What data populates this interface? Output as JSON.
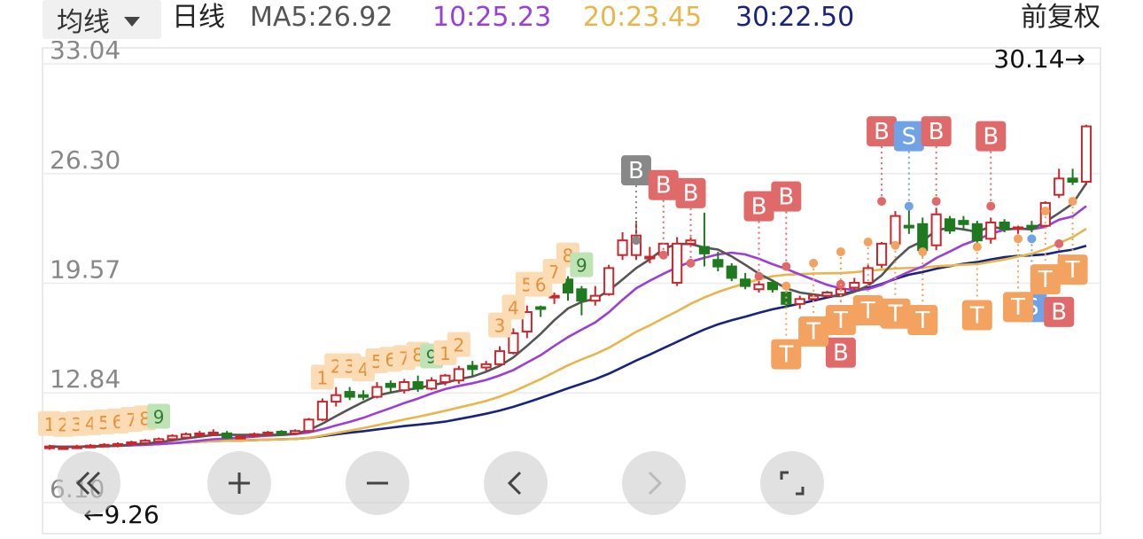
{
  "header": {
    "ma_selector": "均线",
    "period": "日线",
    "ma5": "MA5:26.92",
    "ma10": "10:25.23",
    "ma20": "20:23.45",
    "ma30": "30:22.50",
    "adjust": "前复权"
  },
  "colors": {
    "up": "#c8282d",
    "down": "#1f7a1f",
    "ma5": "#555555",
    "ma10": "#9b3fd6",
    "ma20": "#e8b64a",
    "ma30": "#1a237e",
    "buy": "#e06a6a",
    "sell": "#6fa3e6",
    "buy_gray": "#888888",
    "t_box": "#f3a35f"
  },
  "controls": [
    {
      "name": "double-left-icon"
    },
    {
      "name": "plus-icon"
    },
    {
      "name": "minus-icon"
    },
    {
      "name": "left-icon"
    },
    {
      "name": "right-icon"
    },
    {
      "name": "fullscreen-icon"
    }
  ],
  "chart_data": {
    "type": "candlestick",
    "y_axis_labels": [
      "33.04",
      "26.30",
      "19.57",
      "12.84",
      "6.10"
    ],
    "ylim": [
      6.1,
      33.04
    ],
    "max_label": "30.14→",
    "min_label": "←9.26",
    "candles": [
      [
        9.5,
        9.55,
        9.35,
        9.65
      ],
      [
        9.45,
        9.5,
        9.35,
        9.6
      ],
      [
        9.5,
        9.55,
        9.4,
        9.65
      ],
      [
        9.55,
        9.6,
        9.45,
        9.7
      ],
      [
        9.6,
        9.65,
        9.5,
        9.75
      ],
      [
        9.62,
        9.7,
        9.5,
        9.8
      ],
      [
        9.7,
        9.8,
        9.6,
        9.9
      ],
      [
        9.75,
        9.9,
        9.65,
        10.0
      ],
      [
        9.85,
        10.0,
        9.75,
        10.1
      ],
      [
        10.0,
        10.2,
        9.9,
        10.3
      ],
      [
        10.1,
        10.3,
        10.0,
        10.4
      ],
      [
        10.25,
        10.35,
        10.1,
        10.5
      ],
      [
        10.35,
        10.4,
        10.2,
        10.6
      ],
      [
        10.35,
        10.1,
        10.0,
        10.5
      ],
      [
        10.1,
        10.15,
        10.0,
        10.25
      ],
      [
        10.2,
        10.3,
        10.1,
        10.4
      ],
      [
        10.3,
        10.4,
        10.2,
        10.5
      ],
      [
        10.45,
        10.35,
        10.25,
        10.55
      ],
      [
        10.35,
        10.5,
        10.3,
        10.6
      ],
      [
        10.5,
        11.2,
        10.4,
        11.3
      ],
      [
        11.2,
        12.3,
        11.1,
        12.5
      ],
      [
        12.3,
        12.7,
        12.0,
        13.2
      ],
      [
        12.9,
        12.6,
        12.4,
        13.2
      ],
      [
        12.7,
        12.6,
        12.4,
        13.0
      ],
      [
        12.6,
        13.2,
        12.5,
        13.5
      ],
      [
        13.4,
        13.2,
        12.8,
        13.6
      ],
      [
        13.0,
        13.5,
        12.8,
        13.7
      ],
      [
        13.5,
        13.1,
        12.9,
        13.9
      ],
      [
        13.1,
        13.6,
        13.0,
        13.8
      ],
      [
        13.5,
        13.9,
        13.3,
        14.0
      ],
      [
        13.6,
        14.3,
        13.4,
        14.5
      ],
      [
        14.5,
        14.3,
        13.9,
        14.8
      ],
      [
        14.4,
        14.6,
        14.2,
        14.8
      ],
      [
        14.6,
        15.4,
        14.5,
        15.7
      ],
      [
        15.3,
        16.5,
        15.2,
        16.8
      ],
      [
        16.6,
        17.8,
        16.2,
        18.2
      ],
      [
        18.1,
        18.0,
        17.5,
        18.2
      ],
      [
        18.8,
        18.8,
        18.3,
        19.0
      ],
      [
        19.8,
        19.0,
        18.5,
        20.0
      ],
      [
        19.2,
        18.5,
        17.6,
        19.4
      ],
      [
        18.5,
        18.8,
        18.2,
        19.4
      ],
      [
        18.9,
        20.5,
        18.8,
        20.7
      ],
      [
        21.3,
        22.2,
        21.0,
        22.7
      ],
      [
        21.3,
        22.5,
        21.0,
        23.4
      ],
      [
        21.2,
        21.2,
        20.8,
        21.8
      ],
      [
        21.3,
        22.0,
        21.2,
        22.0
      ],
      [
        19.6,
        22.0,
        19.4,
        22.4
      ],
      [
        22.0,
        22.2,
        21.8,
        22.4
      ],
      [
        21.8,
        21.4,
        20.6,
        23.9
      ],
      [
        21.0,
        20.6,
        20.3,
        21.5
      ],
      [
        20.6,
        19.9,
        19.7,
        20.8
      ],
      [
        19.8,
        19.4,
        19.2,
        20.2
      ],
      [
        19.2,
        19.5,
        19.0,
        19.7
      ],
      [
        19.6,
        19.2,
        19.0,
        19.8
      ],
      [
        19.0,
        18.3,
        18.1,
        19.1
      ],
      [
        18.3,
        18.6,
        18.0,
        18.8
      ],
      [
        18.6,
        18.8,
        18.6,
        18.9
      ],
      [
        18.8,
        19.0,
        18.7,
        19.1
      ],
      [
        18.9,
        19.2,
        18.8,
        19.3
      ],
      [
        19.3,
        19.6,
        19.1,
        19.9
      ],
      [
        19.6,
        20.5,
        19.5,
        20.7
      ],
      [
        20.7,
        22.0,
        20.5,
        22.1
      ],
      [
        22.0,
        23.7,
        21.8,
        24.0
      ],
      [
        23.1,
        23.0,
        22.6,
        24.1
      ],
      [
        23.2,
        21.6,
        21.2,
        23.6
      ],
      [
        21.9,
        23.8,
        21.6,
        24.2
      ],
      [
        23.5,
        22.8,
        22.6,
        23.7
      ],
      [
        23.4,
        23.2,
        22.8,
        23.7
      ],
      [
        23.2,
        22.2,
        22.0,
        23.4
      ],
      [
        22.3,
        23.3,
        22.0,
        23.6
      ],
      [
        23.3,
        22.9,
        22.7,
        23.5
      ],
      [
        22.9,
        23.0,
        22.6,
        23.1
      ],
      [
        23.1,
        23.0,
        22.7,
        23.4
      ],
      [
        23.1,
        24.5,
        23.0,
        24.6
      ],
      [
        25.0,
        26.0,
        24.8,
        26.6
      ],
      [
        26.0,
        25.8,
        25.6,
        26.6
      ],
      [
        25.8,
        29.2,
        25.6,
        29.3
      ]
    ],
    "tags": [
      {
        "i": 0,
        "n": "1"
      },
      {
        "i": 1,
        "n": "2"
      },
      {
        "i": 2,
        "n": "3"
      },
      {
        "i": 3,
        "n": "4"
      },
      {
        "i": 4,
        "n": "5"
      },
      {
        "i": 5,
        "n": "6"
      },
      {
        "i": 6,
        "n": "7"
      },
      {
        "i": 7,
        "n": "8"
      },
      {
        "i": 8,
        "n": "9"
      },
      {
        "i": 20,
        "n": "1"
      },
      {
        "i": 21,
        "n": "2"
      },
      {
        "i": 22,
        "n": "3"
      },
      {
        "i": 23,
        "n": "4"
      },
      {
        "i": 24,
        "n": "5"
      },
      {
        "i": 25,
        "n": "6"
      },
      {
        "i": 26,
        "n": "7"
      },
      {
        "i": 27,
        "n": "8"
      },
      {
        "i": 28,
        "n": "9"
      },
      {
        "i": 29,
        "n": "1"
      },
      {
        "i": 30,
        "n": "2"
      },
      {
        "i": 33,
        "n": "3"
      },
      {
        "i": 34,
        "n": "4"
      },
      {
        "i": 35,
        "n": "5"
      },
      {
        "i": 36,
        "n": "6"
      },
      {
        "i": 37,
        "n": "7"
      },
      {
        "i": 38,
        "n": "8"
      },
      {
        "i": 39,
        "n": "9"
      }
    ],
    "markers": [
      {
        "i": 43,
        "label": "B",
        "kind": "gray",
        "side": "top",
        "price": 22.2
      },
      {
        "i": 45,
        "label": "B",
        "kind": "buy",
        "side": "top",
        "price": 21.3
      },
      {
        "i": 47,
        "label": "B",
        "kind": "buy",
        "side": "top",
        "price": 20.8
      },
      {
        "i": 52,
        "label": "B",
        "kind": "buy",
        "side": "top",
        "price": 20.0
      },
      {
        "i": 54,
        "label": "B",
        "kind": "buy",
        "side": "top",
        "price": 20.6
      },
      {
        "i": 58,
        "label": "B",
        "kind": "buy",
        "side": "bottom",
        "price": 19.5
      },
      {
        "i": 61,
        "label": "B",
        "kind": "buy",
        "side": "top",
        "price": 24.6
      },
      {
        "i": 63,
        "label": "S",
        "kind": "sell",
        "side": "top",
        "price": 24.3
      },
      {
        "i": 65,
        "label": "B",
        "kind": "buy",
        "side": "top",
        "price": 24.6
      },
      {
        "i": 69,
        "label": "B",
        "kind": "buy",
        "side": "top",
        "price": 24.3
      },
      {
        "i": 72,
        "label": "S",
        "kind": "sell",
        "side": "bottom",
        "price": 22.3
      },
      {
        "i": 74,
        "label": "B",
        "kind": "buy",
        "side": "bottom",
        "price": 22.0
      },
      {
        "i": 54,
        "label": "T",
        "kind": "t",
        "side": "bottom",
        "price": 19.4
      },
      {
        "i": 56,
        "label": "T",
        "kind": "t",
        "side": "bottom",
        "price": 20.8
      },
      {
        "i": 58,
        "label": "T",
        "kind": "t",
        "side": "bottom",
        "price": 21.5
      },
      {
        "i": 60,
        "label": "T",
        "kind": "t",
        "side": "bottom",
        "price": 22.1
      },
      {
        "i": 62,
        "label": "T",
        "kind": "t",
        "side": "bottom",
        "price": 21.9
      },
      {
        "i": 64,
        "label": "T",
        "kind": "t",
        "side": "bottom",
        "price": 21.5
      },
      {
        "i": 68,
        "label": "T",
        "kind": "t",
        "side": "bottom",
        "price": 21.8
      },
      {
        "i": 71,
        "label": "T",
        "kind": "t",
        "side": "bottom",
        "price": 22.3
      },
      {
        "i": 73,
        "label": "T",
        "kind": "t",
        "side": "bottom",
        "price": 24.0
      },
      {
        "i": 75,
        "label": "T",
        "kind": "t",
        "side": "bottom",
        "price": 24.6
      }
    ]
  }
}
